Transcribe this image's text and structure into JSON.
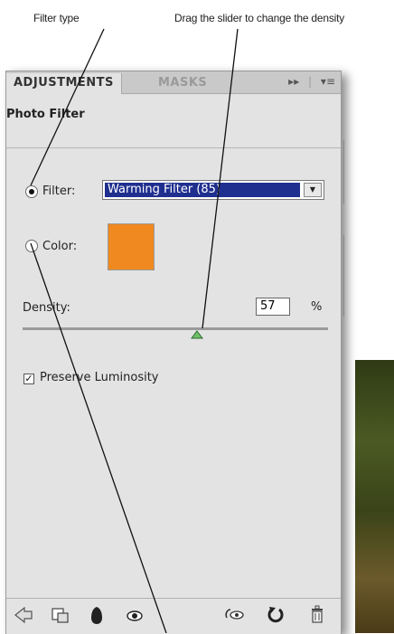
{
  "callouts": {
    "filter_type": "Filter type",
    "drag_slider": "Drag the slider to change the density"
  },
  "panel": {
    "tabs": [
      {
        "label": "ADJUSTMENTS",
        "active": true
      },
      {
        "label": "MASKS",
        "active": false
      }
    ],
    "menu_icons": [
      "forward-double-icon",
      "panel-menu-icon"
    ],
    "title": "Photo Filter",
    "filter": {
      "label": "Filter:",
      "selected": true,
      "value": "Warming Filter (85)"
    },
    "color": {
      "label": "Color:",
      "selected": false,
      "swatch": "#f08a20"
    },
    "density": {
      "label": "Density:",
      "value": "57",
      "unit": "%",
      "level": 0.57
    },
    "preserve_luminosity": {
      "label": "Preserve Luminosity",
      "checked": true
    },
    "toolbar_icons": [
      "back-arrow-icon",
      "clip-to-layer-icon",
      "layer-mask-icon",
      "visibility-eye-icon",
      "view-previous-icon",
      "reset-icon",
      "trash-icon"
    ]
  },
  "colors": {
    "panel_bg": "#e3e3e3",
    "selection_bg": "#1f2f8f",
    "slider_thumb": "#6fbf6a"
  }
}
